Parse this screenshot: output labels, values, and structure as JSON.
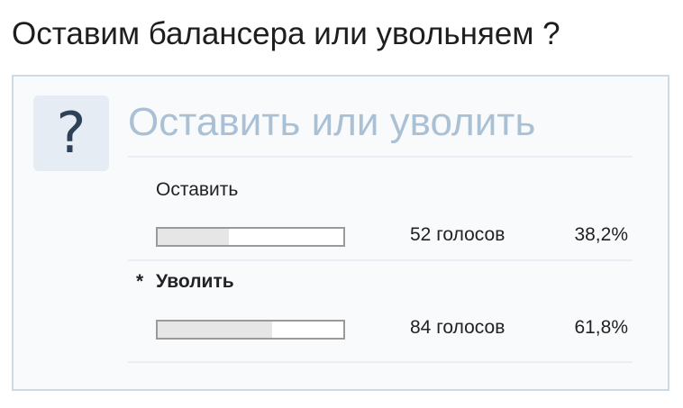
{
  "topic": {
    "title": "Оставим балансера или увольняем ?"
  },
  "poll": {
    "icon": "question-mark-icon",
    "icon_glyph": "?",
    "question": "Оставить или уволить",
    "options": [
      {
        "label": "Оставить",
        "votes": "52 голосов",
        "percent": "38,2%",
        "fraction": 0.382,
        "selected": false,
        "marker": ""
      },
      {
        "label": "Уволить",
        "votes": "84 голосов",
        "percent": "61,8%",
        "fraction": 0.618,
        "selected": true,
        "marker": "*"
      }
    ]
  },
  "colors": {
    "question_text": "#a9c0d5",
    "box_border": "#cddbe7",
    "icon_bg": "#e5ecf4",
    "bar_fill": "#e6e6e6"
  }
}
